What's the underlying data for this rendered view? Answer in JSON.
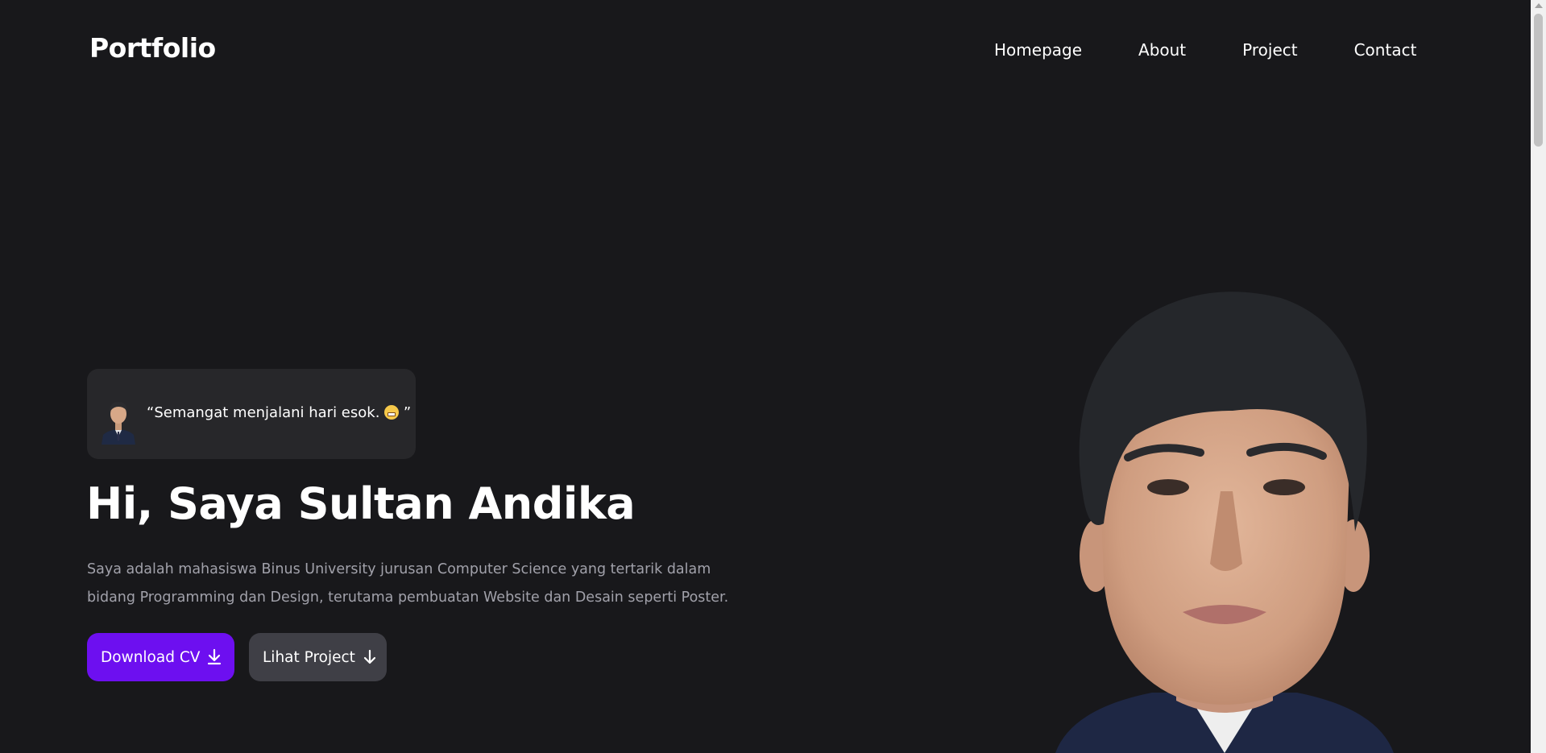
{
  "navbar": {
    "logo": "Portfolio",
    "links": [
      "Homepage",
      "About",
      "Project",
      "Contact"
    ]
  },
  "hero": {
    "quote": {
      "text": "“Semangat menjalani hari esok.",
      "closing": " ”",
      "emoji": "grimacing-face-emoji"
    },
    "heading": "Hi, Saya Sultan Andika",
    "description": "Saya adalah mahasiswa Binus University jurusan Computer Science yang tertarik dalam bidang Programming dan Design, terutama pembuatan Website dan Desain seperti Poster.",
    "buttons": {
      "primary": "Download CV",
      "secondary": "Lihat Project"
    }
  },
  "colors": {
    "background": "#18181b",
    "card": "#27272a",
    "primary_button": "#6d0ff0",
    "secondary_button": "#3f3f46",
    "muted_text": "#a1a1aa"
  },
  "icons": {
    "primary_button_icon": "download-icon",
    "secondary_button_icon": "arrow-down-icon"
  }
}
